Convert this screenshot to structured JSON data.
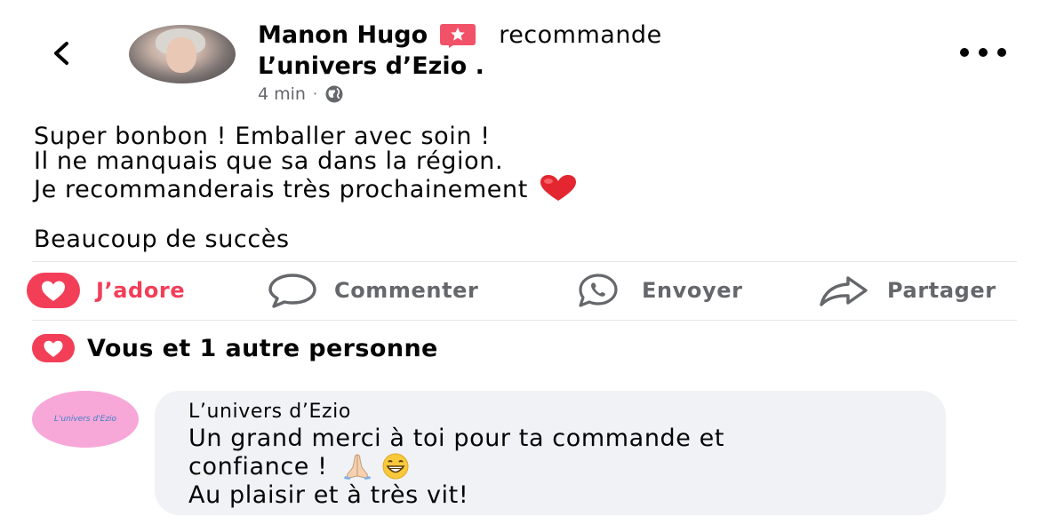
{
  "header": {
    "author": "Manon Hugo",
    "verb": "recommande",
    "page": "L’univers d’Ezio .",
    "time": "4 min",
    "separator": "·",
    "privacy_icon": "globe-icon",
    "badge_icon": "recommendation-star-icon",
    "back_icon": "chevron-left-icon",
    "more_icon": "more-dots-icon"
  },
  "post": {
    "lines": [
      "Super bonbon ! Emballer avec soin !",
      "Il ne manquais que sa dans la région.",
      "Je recommanderais très prochainement"
    ],
    "closing": "Beaucoup de succès",
    "emoji": "red-heart-emoji"
  },
  "actions": {
    "like": "J’adore",
    "comment": "Commenter",
    "send": "Envoyer",
    "share": "Partager"
  },
  "reactions": {
    "summary": "Vous et 1 autre personne",
    "icon": "love-reaction-icon"
  },
  "comment": {
    "avatar_text": "L'univers d'Ezio",
    "author": "L’univers d’Ezio",
    "line1": "Un grand merci à toi pour ta commande et",
    "line2": "confiance !",
    "line3": "Au plaisir et à très vit!",
    "emojis": [
      "folded-hands-emoji",
      "grinning-face-emoji"
    ]
  },
  "colors": {
    "love": "#f33e58",
    "muted": "#65676b",
    "bubble": "#f0f2f5",
    "comment_avatar": "#f7a8d8"
  }
}
